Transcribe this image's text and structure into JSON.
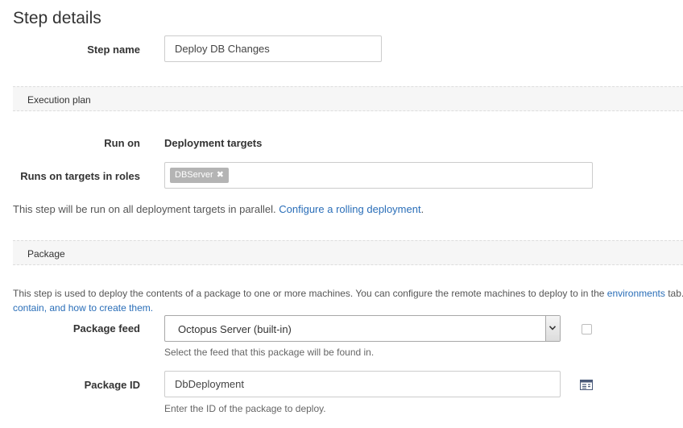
{
  "page": {
    "title": "Step details"
  },
  "step_name": {
    "label": "Step name",
    "value": "Deploy DB Changes"
  },
  "execution_plan": {
    "header": "Execution plan",
    "run_on": {
      "label": "Run on",
      "value": "Deployment targets"
    },
    "roles": {
      "label": "Runs on targets in roles",
      "tags": [
        "DBServer"
      ],
      "remove_glyph": "✖"
    },
    "parallel_text": "This step will be run on all deployment targets in parallel.",
    "rolling_link": "Configure a rolling deployment",
    "rolling_suffix": "."
  },
  "package": {
    "header": "Package",
    "description_before": "This step is used to deploy the contents of a package to one or more machines. You can configure the remote machines to deploy to in the",
    "environments_link": "environments",
    "description_after": "tab.",
    "line2": "contain, and how to create them.",
    "feed": {
      "label": "Package feed",
      "value": "Octopus Server (built-in)",
      "help": "Select the feed that this package will be found in."
    },
    "package_id": {
      "label": "Package ID",
      "value": "DbDeployment",
      "help": "Enter the ID of the package to deploy."
    }
  },
  "icons": {
    "dropdown": "chevron-down-icon",
    "package_browser": "package-list-icon"
  }
}
